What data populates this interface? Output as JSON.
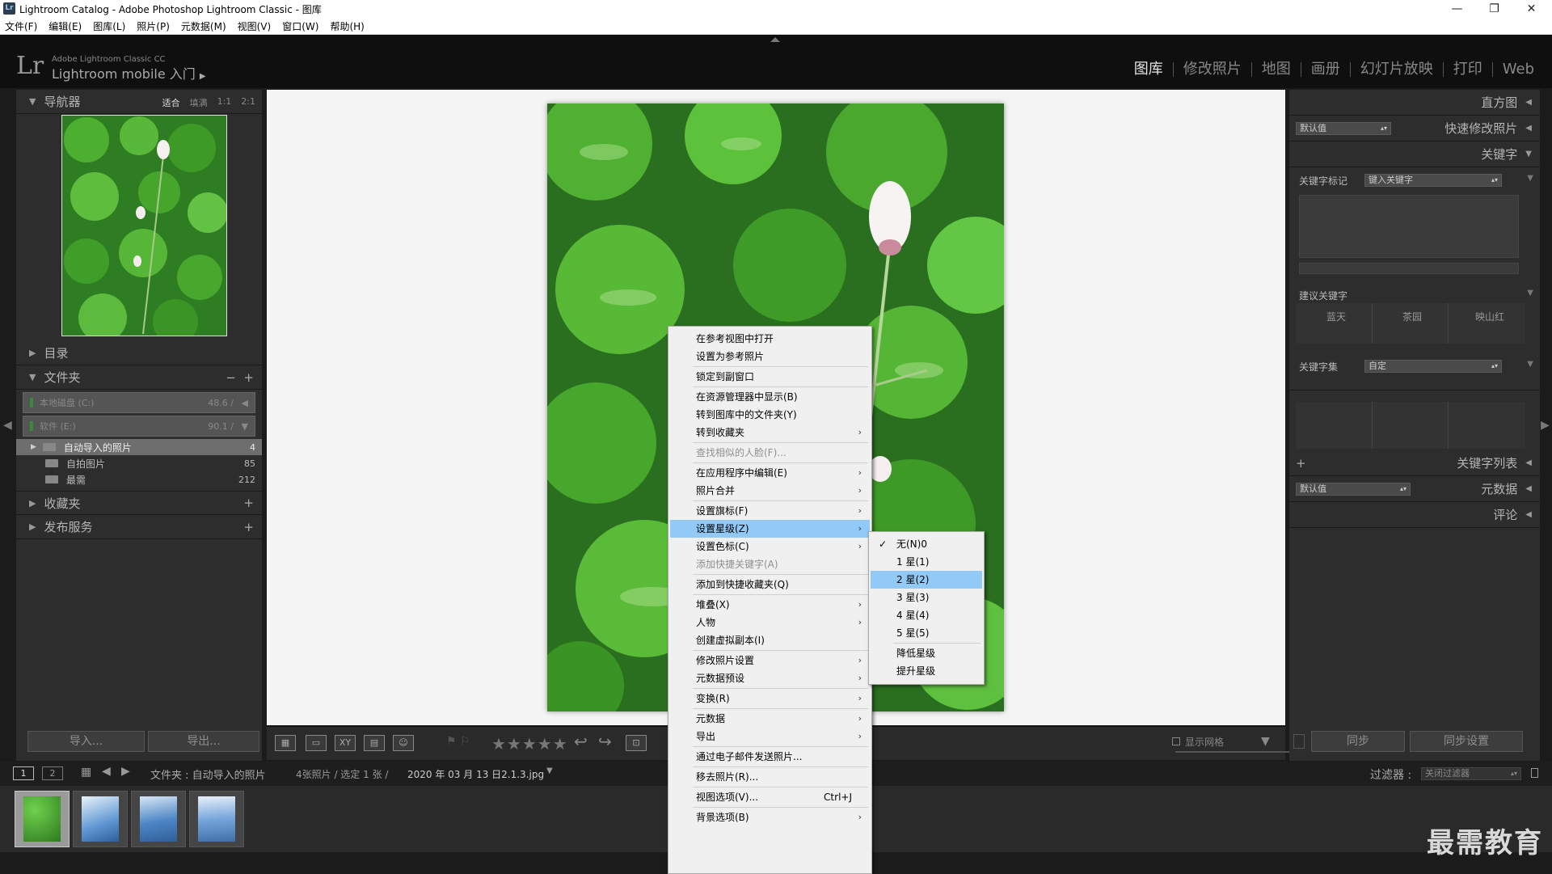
{
  "window": {
    "title": "Lightroom Catalog - Adobe Photoshop Lightroom Classic - 图库",
    "icon_text": "Lr"
  },
  "menubar": [
    "文件(F)",
    "编辑(E)",
    "图库(L)",
    "照片(P)",
    "元数据(M)",
    "视图(V)",
    "窗口(W)",
    "帮助(H)"
  ],
  "identity": {
    "logo": "Lr",
    "line1": "Adobe Lightroom Classic CC",
    "line2": "Lightroom mobile 入门"
  },
  "modules": [
    "图库",
    "修改照片",
    "地图",
    "画册",
    "幻灯片放映",
    "打印",
    "Web"
  ],
  "left": {
    "navigator": {
      "title": "导航器",
      "opts": [
        "适合",
        "填满",
        "1:1",
        "2:1"
      ]
    },
    "catalog": "目录",
    "folders": {
      "title": "文件夹",
      "disk_c": "本地磁盘 (C:)",
      "disk_c_val": "48.6 /",
      "disk_e": "软件 (E:)",
      "disk_e_val": "90.1 /"
    },
    "folder_items": [
      {
        "name": "自动导入的照片",
        "count": "4"
      },
      {
        "name": "自拍图片",
        "count": "85"
      },
      {
        "name": "最需",
        "count": "212"
      }
    ],
    "collections": "收藏夹",
    "publish": "发布服务",
    "import_btn": "导入...",
    "export_btn": "导出..."
  },
  "toolbar": {
    "stars": "★★★★★",
    "show_grid": "显示网格"
  },
  "right": {
    "histogram": "直方图",
    "quick_develop": "快速修改照片",
    "quick_preset": "默认值",
    "keywording": "关键字",
    "kw_tags_label": "关键字标记",
    "kw_tags_value": "键入关键字",
    "suggested": "建议关键字",
    "suggested_items": [
      "蓝天",
      "茶园",
      "映山红"
    ],
    "kw_set_label": "关键字集",
    "kw_set_value": "自定",
    "kw_list": "关键字列表",
    "metadata": "元数据",
    "metadata_preset": "默认值",
    "comments": "评论",
    "sync_btn": "同步",
    "sync_settings_btn": "同步设置"
  },
  "filmbar": {
    "page1": "1",
    "page2": "2",
    "source": "文件夹 : 自动导入的照片",
    "info": "4张照片 / 选定 1 张 / ",
    "file": "2020 年 03 月 13 日2.1.3.jpg",
    "filter_label": "过滤器 :",
    "filter_value": "关闭过滤器"
  },
  "context_menu": [
    {
      "label": "在参考视图中打开"
    },
    {
      "label": "设置为参考照片"
    },
    {
      "sep": true
    },
    {
      "label": "锁定到副窗口"
    },
    {
      "sep": true
    },
    {
      "label": "在资源管理器中显示(B)"
    },
    {
      "label": "转到图库中的文件夹(Y)"
    },
    {
      "label": "转到收藏夹",
      "arrow": true
    },
    {
      "sep": true
    },
    {
      "label": "查找相似的人脸(F)...",
      "disabled": true
    },
    {
      "sep": true
    },
    {
      "label": "在应用程序中编辑(E)",
      "arrow": true
    },
    {
      "label": "照片合并",
      "arrow": true
    },
    {
      "sep": true
    },
    {
      "label": "设置旗标(F)",
      "arrow": true
    },
    {
      "label": "设置星级(Z)",
      "arrow": true,
      "highlight": true
    },
    {
      "label": "设置色标(C)",
      "arrow": true
    },
    {
      "label": "添加快捷关键字(A)",
      "disabled": true
    },
    {
      "sep": true
    },
    {
      "label": "添加到快捷收藏夹(Q)"
    },
    {
      "sep": true
    },
    {
      "label": "堆叠(X)",
      "arrow": true
    },
    {
      "label": "人物",
      "arrow": true
    },
    {
      "label": "创建虚拟副本(I)"
    },
    {
      "sep": true
    },
    {
      "label": "修改照片设置",
      "arrow": true
    },
    {
      "label": "元数据预设",
      "arrow": true
    },
    {
      "sep": true
    },
    {
      "label": "变换(R)",
      "arrow": true
    },
    {
      "sep": true
    },
    {
      "label": "元数据",
      "arrow": true
    },
    {
      "label": "导出",
      "arrow": true
    },
    {
      "sep": true
    },
    {
      "label": "通过电子邮件发送照片..."
    },
    {
      "sep": true
    },
    {
      "label": "移去照片(R)..."
    },
    {
      "sep": true
    },
    {
      "label": "视图选项(V)...",
      "shortcut": "Ctrl+J"
    },
    {
      "sep": true
    },
    {
      "label": "背景选项(B)",
      "arrow": true
    }
  ],
  "rating_submenu": [
    {
      "label": "无(N)",
      "shortcut": "0",
      "checked": true
    },
    {
      "label": "1 星(1)"
    },
    {
      "label": "2 星(2)",
      "highlight": true
    },
    {
      "label": "3 星(3)"
    },
    {
      "label": "4 星(4)"
    },
    {
      "label": "5 星(5)"
    },
    {
      "sep": true
    },
    {
      "label": "降低星级"
    },
    {
      "label": "提升星级"
    }
  ],
  "watermark": "最需教育",
  "colors": {
    "highlight": "#91c9f7",
    "background": "#1b1b1b",
    "panel": "#2d2d2d"
  }
}
